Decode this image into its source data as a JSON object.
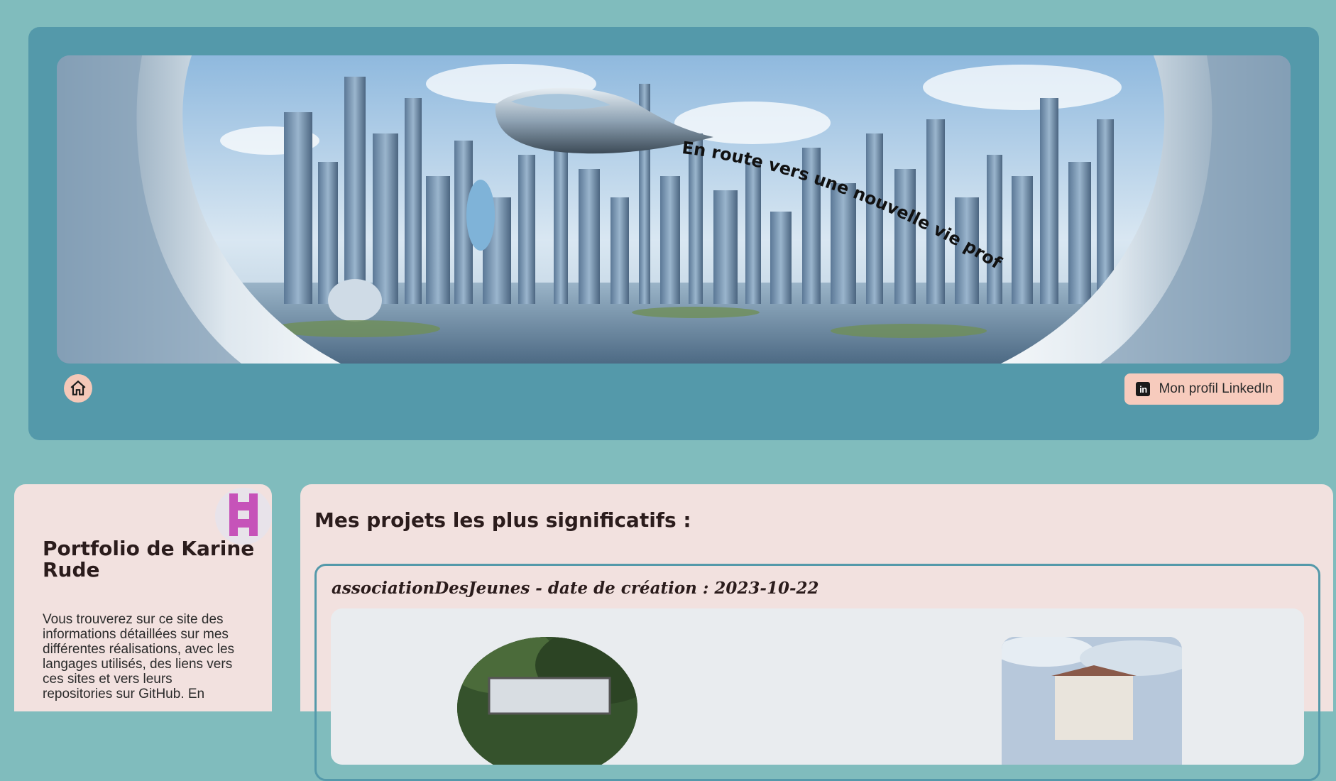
{
  "header": {
    "banner_slogan": "En route vers une nouvelle vie professionnelle",
    "linkedin_label": "Mon profil LinkedIn",
    "linkedin_icon": "linkedin-icon",
    "linkedin_icon_text": "in",
    "home_icon": "home-icon"
  },
  "sidebar": {
    "title": "Portfolio de Karine Rude",
    "intro": "Vous trouverez sur ce site des informations détaillées sur mes différentes réalisations, avec les langages utilisés, des liens vers ces sites et vers leurs repositories sur GitHub. En"
  },
  "main": {
    "title": "Mes projets les plus significatifs :",
    "projects": [
      {
        "title": "associationDesJeunes - date de création : 2023-10-22"
      }
    ]
  },
  "colors": {
    "page_bg": "#80bcbd",
    "header_bg": "#5499aa",
    "panel_bg": "#f2e1df",
    "button_bg": "#f7cbbd",
    "avatar_accent": "#c653b9"
  }
}
